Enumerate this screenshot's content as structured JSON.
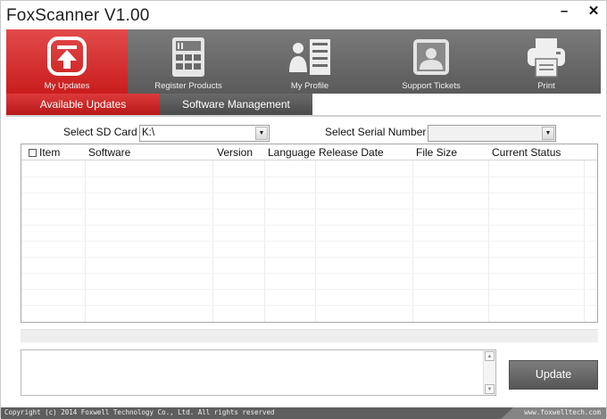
{
  "window": {
    "title": "FoxScanner  V1.00",
    "minimize_glyph": "–",
    "close_glyph": "✕"
  },
  "toolbar": {
    "items": [
      {
        "label": "My Updates",
        "icon": "upload-arrow-icon",
        "active": true
      },
      {
        "label": "Register Products",
        "icon": "calculator-icon",
        "active": false
      },
      {
        "label": "My Profile",
        "icon": "profile-list-icon",
        "active": false
      },
      {
        "label": "Support Tickets",
        "icon": "support-person-icon",
        "active": false
      },
      {
        "label": "Print",
        "icon": "printer-icon",
        "active": false
      }
    ]
  },
  "subtabs": [
    {
      "label": "Available Updates",
      "active": true
    },
    {
      "label": "Software Management",
      "active": false
    }
  ],
  "sd_card": {
    "label": "Select SD Card",
    "value": "K:\\"
  },
  "serial": {
    "label": "Select Serial Number",
    "value": ""
  },
  "table": {
    "columns": [
      "Item",
      "Software",
      "Version",
      "Language",
      "Release Date",
      "File Size",
      "Current Status"
    ],
    "rows": []
  },
  "update_button": {
    "label": "Update"
  },
  "statusbar": {
    "copyright": "Copyright (c) 2014 Foxwell Technology Co., Ltd. All rights reserved",
    "website": "www.foxwelltech.com"
  },
  "colors": {
    "accent_red": "#d22b2b",
    "toolbar_gray": "#666666"
  }
}
